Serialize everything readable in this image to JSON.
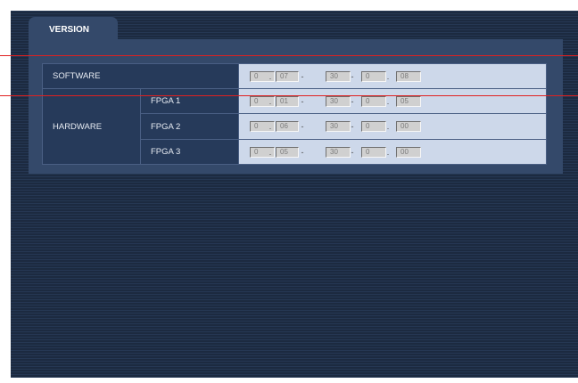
{
  "tab": {
    "label": "VERSION"
  },
  "rows": {
    "software": {
      "label": "SOFTWARE",
      "values": [
        "0",
        "07",
        "30",
        "0",
        "08"
      ]
    },
    "hardware": {
      "label": "HARDWARE",
      "fpga1": {
        "label": "FPGA 1",
        "values": [
          "0",
          "01",
          "30",
          "0",
          "05"
        ]
      },
      "fpga2": {
        "label": "FPGA 2",
        "values": [
          "0",
          "06",
          "30",
          "0",
          "00"
        ]
      },
      "fpga3": {
        "label": "FPGA 3",
        "values": [
          "0",
          "05",
          "30",
          "0",
          "00"
        ]
      }
    }
  },
  "separators": [
    ".",
    "-",
    "-",
    "."
  ],
  "colors": {
    "background": "#1f2d45",
    "panel": "#34496a",
    "cell": "#263a5a",
    "value_cell": "#cdd8ea",
    "field": "#d0d0d0",
    "annotation_line": "#e02020"
  }
}
